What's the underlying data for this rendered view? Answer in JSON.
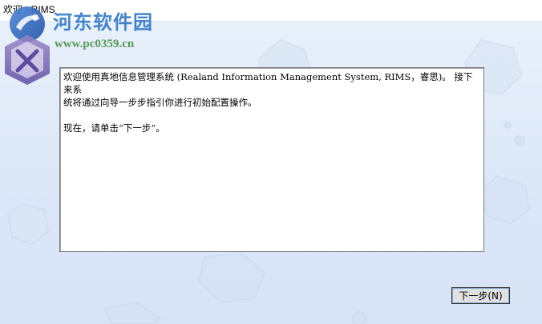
{
  "window": {
    "title": "欢迎 - RIMS"
  },
  "watermark": {
    "site_name": "河东软件园",
    "site_url": "www.pc0359.cn"
  },
  "message": {
    "paragraph1_line1": "欢迎使用真地信息管理系统 (Realand Information Management System, RIMS，睿思)。 接下来系",
    "paragraph1_line2": "统将通过向导一步步指引你进行初始配置操作。",
    "paragraph2": "现在，请单击“下一步”。"
  },
  "buttons": {
    "next_label": "下一步(N)"
  },
  "colors": {
    "background": "#dfe9f7",
    "watermark_blue": "#2f78c8",
    "watermark_green": "#3a8a3a"
  }
}
